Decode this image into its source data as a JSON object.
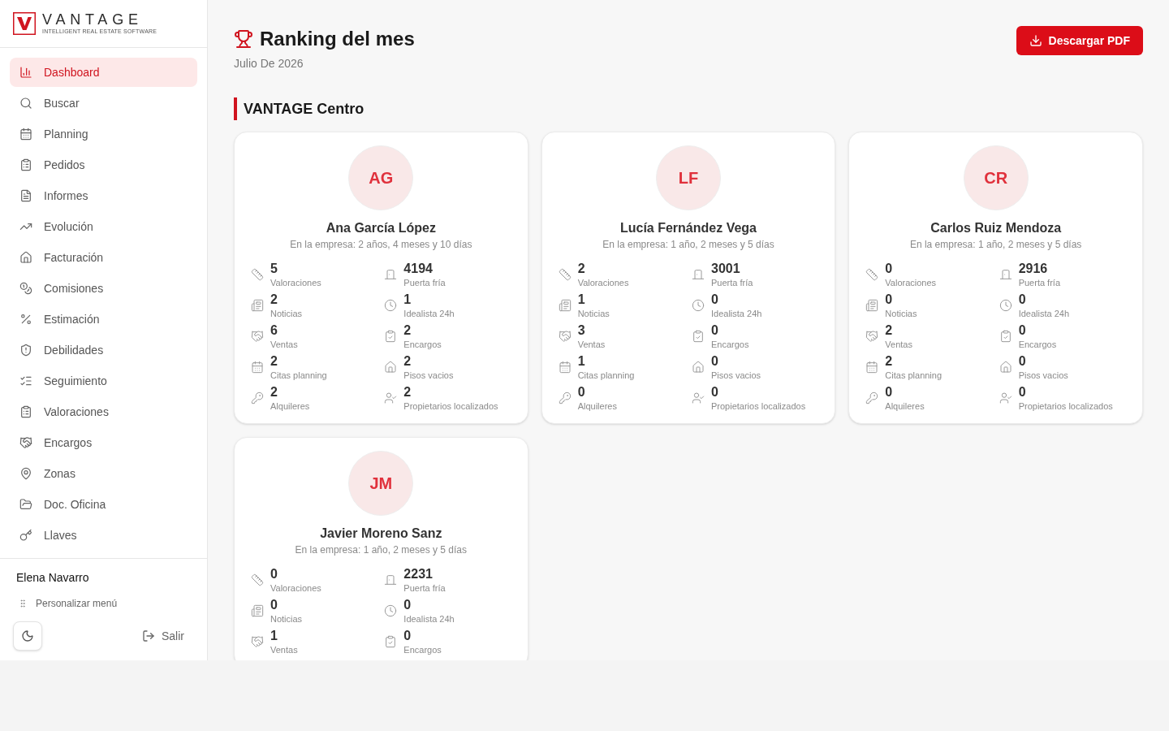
{
  "sidebar": {
    "logo": {
      "wordmark": "VANTAGE",
      "tagline": "INTELLIGENT REAL ESTATE SOFTWARE"
    },
    "items": [
      {
        "label": "Dashboard",
        "selected": true
      },
      {
        "label": "Buscar",
        "selected": false
      },
      {
        "label": "Planning",
        "selected": false
      },
      {
        "label": "Pedidos",
        "selected": false
      },
      {
        "label": "Informes",
        "selected": false
      },
      {
        "label": "Evolución",
        "selected": false
      },
      {
        "label": "Facturación",
        "selected": false
      },
      {
        "label": "Comisiones",
        "selected": false
      },
      {
        "label": "Estimación",
        "selected": false
      },
      {
        "label": "Debilidades",
        "selected": false
      },
      {
        "label": "Seguimiento",
        "selected": false
      },
      {
        "label": "Valoraciones",
        "selected": false
      },
      {
        "label": "Encargos",
        "selected": false
      },
      {
        "label": "Zonas",
        "selected": false
      },
      {
        "label": "Doc. Oficina",
        "selected": false
      },
      {
        "label": "Llaves",
        "selected": false
      }
    ],
    "user": {
      "name": "Elena Navarro"
    },
    "customize_menu": "Personalizar menú",
    "logout": "Salir"
  },
  "header": {
    "title": "Ranking del mes",
    "subtitle": "Julio De 2026",
    "download_button": "Descargar PDF"
  },
  "sections": [
    {
      "title": "VANTAGE Centro",
      "agents": [
        {
          "initials": "AG",
          "name": "Ana García López",
          "tenure": "En la empresa: 2 años, 4 meses y 10 días",
          "stats": [
            {
              "value": "5",
              "label": "Valoraciones"
            },
            {
              "value": "4194",
              "label": "Puerta fría"
            },
            {
              "value": "2",
              "label": "Noticias"
            },
            {
              "value": "1",
              "label": "Idealista 24h"
            },
            {
              "value": "6",
              "label": "Ventas"
            },
            {
              "value": "2",
              "label": "Encargos"
            },
            {
              "value": "2",
              "label": "Citas planning"
            },
            {
              "value": "2",
              "label": "Pisos vacios"
            },
            {
              "value": "2",
              "label": "Alquileres"
            },
            {
              "value": "2",
              "label": "Propietarios localizados"
            }
          ]
        },
        {
          "initials": "LF",
          "name": "Lucía Fernández Vega",
          "tenure": "En la empresa: 1 año, 2 meses y 5 días",
          "stats": [
            {
              "value": "2",
              "label": "Valoraciones"
            },
            {
              "value": "3001",
              "label": "Puerta fría"
            },
            {
              "value": "1",
              "label": "Noticias"
            },
            {
              "value": "0",
              "label": "Idealista 24h"
            },
            {
              "value": "3",
              "label": "Ventas"
            },
            {
              "value": "0",
              "label": "Encargos"
            },
            {
              "value": "1",
              "label": "Citas planning"
            },
            {
              "value": "0",
              "label": "Pisos vacios"
            },
            {
              "value": "0",
              "label": "Alquileres"
            },
            {
              "value": "0",
              "label": "Propietarios localizados"
            }
          ]
        },
        {
          "initials": "CR",
          "name": "Carlos Ruiz Mendoza",
          "tenure": "En la empresa: 1 año, 2 meses y 5 días",
          "stats": [
            {
              "value": "0",
              "label": "Valoraciones"
            },
            {
              "value": "2916",
              "label": "Puerta fría"
            },
            {
              "value": "0",
              "label": "Noticias"
            },
            {
              "value": "0",
              "label": "Idealista 24h"
            },
            {
              "value": "2",
              "label": "Ventas"
            },
            {
              "value": "0",
              "label": "Encargos"
            },
            {
              "value": "2",
              "label": "Citas planning"
            },
            {
              "value": "0",
              "label": "Pisos vacios"
            },
            {
              "value": "0",
              "label": "Alquileres"
            },
            {
              "value": "0",
              "label": "Propietarios localizados"
            }
          ]
        },
        {
          "initials": "JM",
          "name": "Javier Moreno Sanz",
          "tenure": "En la empresa: 1 año, 2 meses y 5 días",
          "stats": [
            {
              "value": "0",
              "label": "Valoraciones"
            },
            {
              "value": "2231",
              "label": "Puerta fría"
            },
            {
              "value": "0",
              "label": "Noticias"
            },
            {
              "value": "0",
              "label": "Idealista 24h"
            },
            {
              "value": "1",
              "label": "Ventas"
            },
            {
              "value": "0",
              "label": "Encargos"
            }
          ]
        }
      ]
    }
  ]
}
